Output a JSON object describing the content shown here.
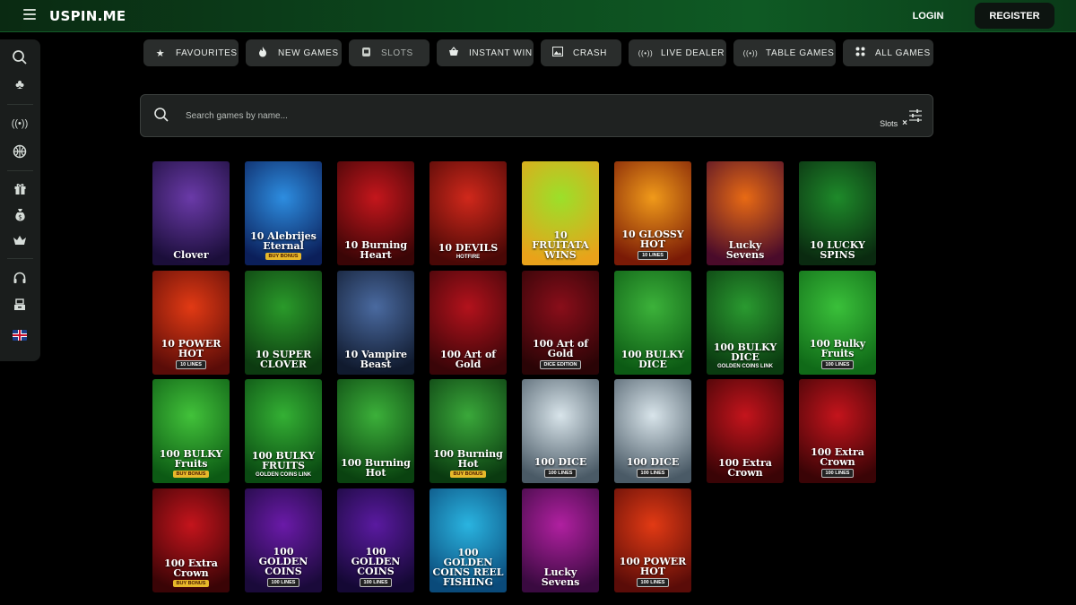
{
  "header": {
    "logo": "USPIN.ME",
    "login_label": "LOGIN",
    "register_label": "REGISTER"
  },
  "sidebar": {
    "icons": [
      "search-icon",
      "club-icon",
      "live-icon",
      "basketball-icon",
      "gift-icon",
      "money-bag-icon",
      "crown-icon",
      "headset-icon",
      "cashier-icon",
      "uk-flag-icon"
    ]
  },
  "categories": [
    {
      "label": "FAVOURITES",
      "icon": "star-icon",
      "dim": false
    },
    {
      "label": "NEW GAMES",
      "icon": "fire-icon",
      "dim": false
    },
    {
      "label": "SLOTS",
      "icon": "slot-icon",
      "dim": true
    },
    {
      "label": "INSTANT WIN",
      "icon": "basket-icon",
      "dim": false
    },
    {
      "label": "CRASH",
      "icon": "image-icon",
      "dim": false
    },
    {
      "label": "LIVE DEALER",
      "icon": "live-icon",
      "dim": false
    },
    {
      "label": "TABLE GAMES",
      "icon": "live-icon",
      "dim": false
    },
    {
      "label": "ALL GAMES",
      "icon": "grid-icon",
      "dim": false
    }
  ],
  "search": {
    "placeholder": "Search games by name...",
    "filter_chip": "Slots",
    "chip_close": "×"
  },
  "games": [
    {
      "title": "Clover",
      "sub": "",
      "badge": "",
      "c1": "#6a3aa8",
      "c2": "#1b0e3a"
    },
    {
      "title": "10 Alebrijes Eternal",
      "sub": "",
      "badge": "BUY BONUS",
      "c1": "#2d8de0",
      "c2": "#0b1f5a"
    },
    {
      "title": "10 Burning Heart",
      "sub": "",
      "badge": "",
      "c1": "#c4161c",
      "c2": "#3a0506"
    },
    {
      "title": "10 DEVILS",
      "sub": "HOTFIRE",
      "badge": "",
      "c1": "#d0281b",
      "c2": "#4a0806"
    },
    {
      "title": "10 FRUITATA WINS",
      "sub": "",
      "badge": "",
      "c1": "#9be02a",
      "c2": "#e9a21a"
    },
    {
      "title": "10 GLOSSY HOT",
      "sub": "",
      "badge": "10 LINES",
      "c1": "#f09a1a",
      "c2": "#7a1a06"
    },
    {
      "title": "Lucky Sevens",
      "sub": "",
      "badge": "",
      "c1": "#e86a14",
      "c2": "#4a0b2a"
    },
    {
      "title": "10 LUCKY SPINS",
      "sub": "",
      "badge": "",
      "c1": "#1e8a2a",
      "c2": "#0a2a10"
    },
    {
      "title": "10 POWER HOT",
      "sub": "",
      "badge": "10 LINES",
      "c1": "#e23a14",
      "c2": "#5a0c08"
    },
    {
      "title": "10 SUPER CLOVER",
      "sub": "",
      "badge": "",
      "c1": "#2a9a2a",
      "c2": "#0c3a10"
    },
    {
      "title": "10 Vampire Beast",
      "sub": "",
      "badge": "",
      "c1": "#4a6aa0",
      "c2": "#101a2e"
    },
    {
      "title": "100 Art of Gold",
      "sub": "",
      "badge": "",
      "c1": "#b3121c",
      "c2": "#3a0508"
    },
    {
      "title": "100 Art of Gold",
      "sub": "",
      "badge": "DICE EDITION",
      "c1": "#8a0e1a",
      "c2": "#2a0406"
    },
    {
      "title": "100 BULKY DICE",
      "sub": "",
      "badge": "",
      "c1": "#3cb23a",
      "c2": "#0c5a14"
    },
    {
      "title": "100 BULKY DICE",
      "sub": "GOLDEN COINS LINK",
      "badge": "",
      "c1": "#2a9a30",
      "c2": "#0a3a10"
    },
    {
      "title": "100 Bulky Fruits",
      "sub": "",
      "badge": "100 LINES",
      "c1": "#3ac03a",
      "c2": "#106a18"
    },
    {
      "title": "100 BULKY Fruits",
      "sub": "",
      "badge": "BUY BONUS",
      "c1": "#42c23a",
      "c2": "#0c5a14"
    },
    {
      "title": "100 BULKY FRUITS",
      "sub": "GOLDEN COINS LINK",
      "badge": "",
      "c1": "#34b034",
      "c2": "#0a4a12"
    },
    {
      "title": "100 Burning Hot",
      "sub": "",
      "badge": "",
      "c1": "#3cb03a",
      "c2": "#0a4210"
    },
    {
      "title": "100 Burning Hot",
      "sub": "",
      "badge": "BUY BONUS",
      "c1": "#3aa83a",
      "c2": "#0a3a10"
    },
    {
      "title": "100 DICE",
      "sub": "",
      "badge": "100 LINES",
      "c1": "#d8e4ea",
      "c2": "#4a5a66"
    },
    {
      "title": "100 DICE",
      "sub": "",
      "badge": "100 LINES",
      "c1": "#d8e4ea",
      "c2": "#4a5a66"
    },
    {
      "title": "100 Extra Crown",
      "sub": "",
      "badge": "",
      "c1": "#c4141c",
      "c2": "#3a0406"
    },
    {
      "title": "100 Extra Crown",
      "sub": "",
      "badge": "100 LINES",
      "c1": "#c4141c",
      "c2": "#3a0406"
    },
    {
      "title": "100 Extra Crown",
      "sub": "",
      "badge": "BUY BONUS",
      "c1": "#c4141c",
      "c2": "#3a0406"
    },
    {
      "title": "100 GOLDEN COINS",
      "sub": "",
      "badge": "100 LINES",
      "c1": "#6a1aa8",
      "c2": "#1a0a3a"
    },
    {
      "title": "100 GOLDEN COINS",
      "sub": "",
      "badge": "100 LINES",
      "c1": "#5a1aa0",
      "c2": "#140834"
    },
    {
      "title": "100 GOLDEN COINS REEL FISHING",
      "sub": "",
      "badge": "",
      "c1": "#2ab4e0",
      "c2": "#0a4a7a"
    },
    {
      "title": "Lucky Sevens",
      "sub": "",
      "badge": "",
      "c1": "#b020a0",
      "c2": "#3a0a40"
    },
    {
      "title": "100 POWER HOT",
      "sub": "",
      "badge": "100 LINES",
      "c1": "#e23a14",
      "c2": "#5a0c08"
    }
  ]
}
